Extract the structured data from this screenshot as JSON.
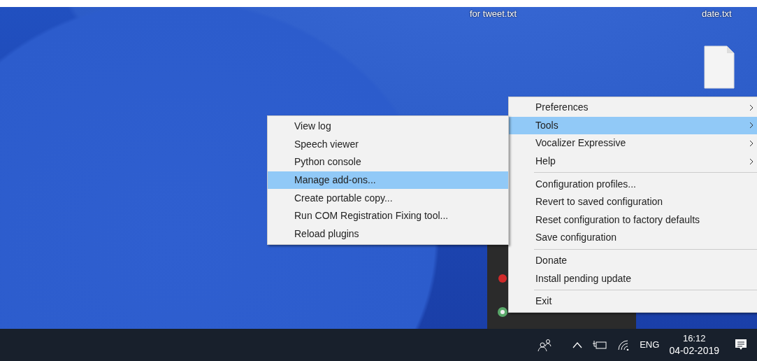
{
  "desktop": {
    "labels": [
      {
        "text": "for tweet.txt"
      },
      {
        "text": "date.txt"
      }
    ]
  },
  "context_menu": {
    "items": [
      {
        "kind": "item",
        "label": "Preferences",
        "submenu": true,
        "selected": false
      },
      {
        "kind": "item",
        "label": "Tools",
        "submenu": true,
        "selected": true
      },
      {
        "kind": "item",
        "label": "Vocalizer Expressive",
        "submenu": true,
        "selected": false
      },
      {
        "kind": "item",
        "label": "Help",
        "submenu": true,
        "selected": false
      },
      {
        "kind": "separator"
      },
      {
        "kind": "item",
        "label": "Configuration profiles...",
        "submenu": false,
        "selected": false
      },
      {
        "kind": "item",
        "label": "Revert to saved configuration",
        "submenu": false,
        "selected": false
      },
      {
        "kind": "item",
        "label": "Reset configuration to factory defaults",
        "submenu": false,
        "selected": false
      },
      {
        "kind": "item",
        "label": "Save configuration",
        "submenu": false,
        "selected": false
      },
      {
        "kind": "separator"
      },
      {
        "kind": "item",
        "label": "Donate",
        "submenu": false,
        "selected": false
      },
      {
        "kind": "item",
        "label": "Install pending update",
        "submenu": false,
        "selected": false
      },
      {
        "kind": "separator"
      },
      {
        "kind": "item",
        "label": "Exit",
        "submenu": false,
        "selected": false
      }
    ]
  },
  "tools_submenu": {
    "items": [
      {
        "label": "View log",
        "selected": false
      },
      {
        "label": "Speech viewer",
        "selected": false
      },
      {
        "label": "Python console",
        "selected": false
      },
      {
        "label": "Manage add-ons...",
        "selected": true
      },
      {
        "label": "Create portable copy...",
        "selected": false
      },
      {
        "label": "Run COM Registration Fixing tool...",
        "selected": false
      },
      {
        "label": "Reload plugins",
        "selected": false
      }
    ]
  },
  "taskbar": {
    "language": "ENG",
    "time": "16:12",
    "date": "04-02-2019"
  }
}
